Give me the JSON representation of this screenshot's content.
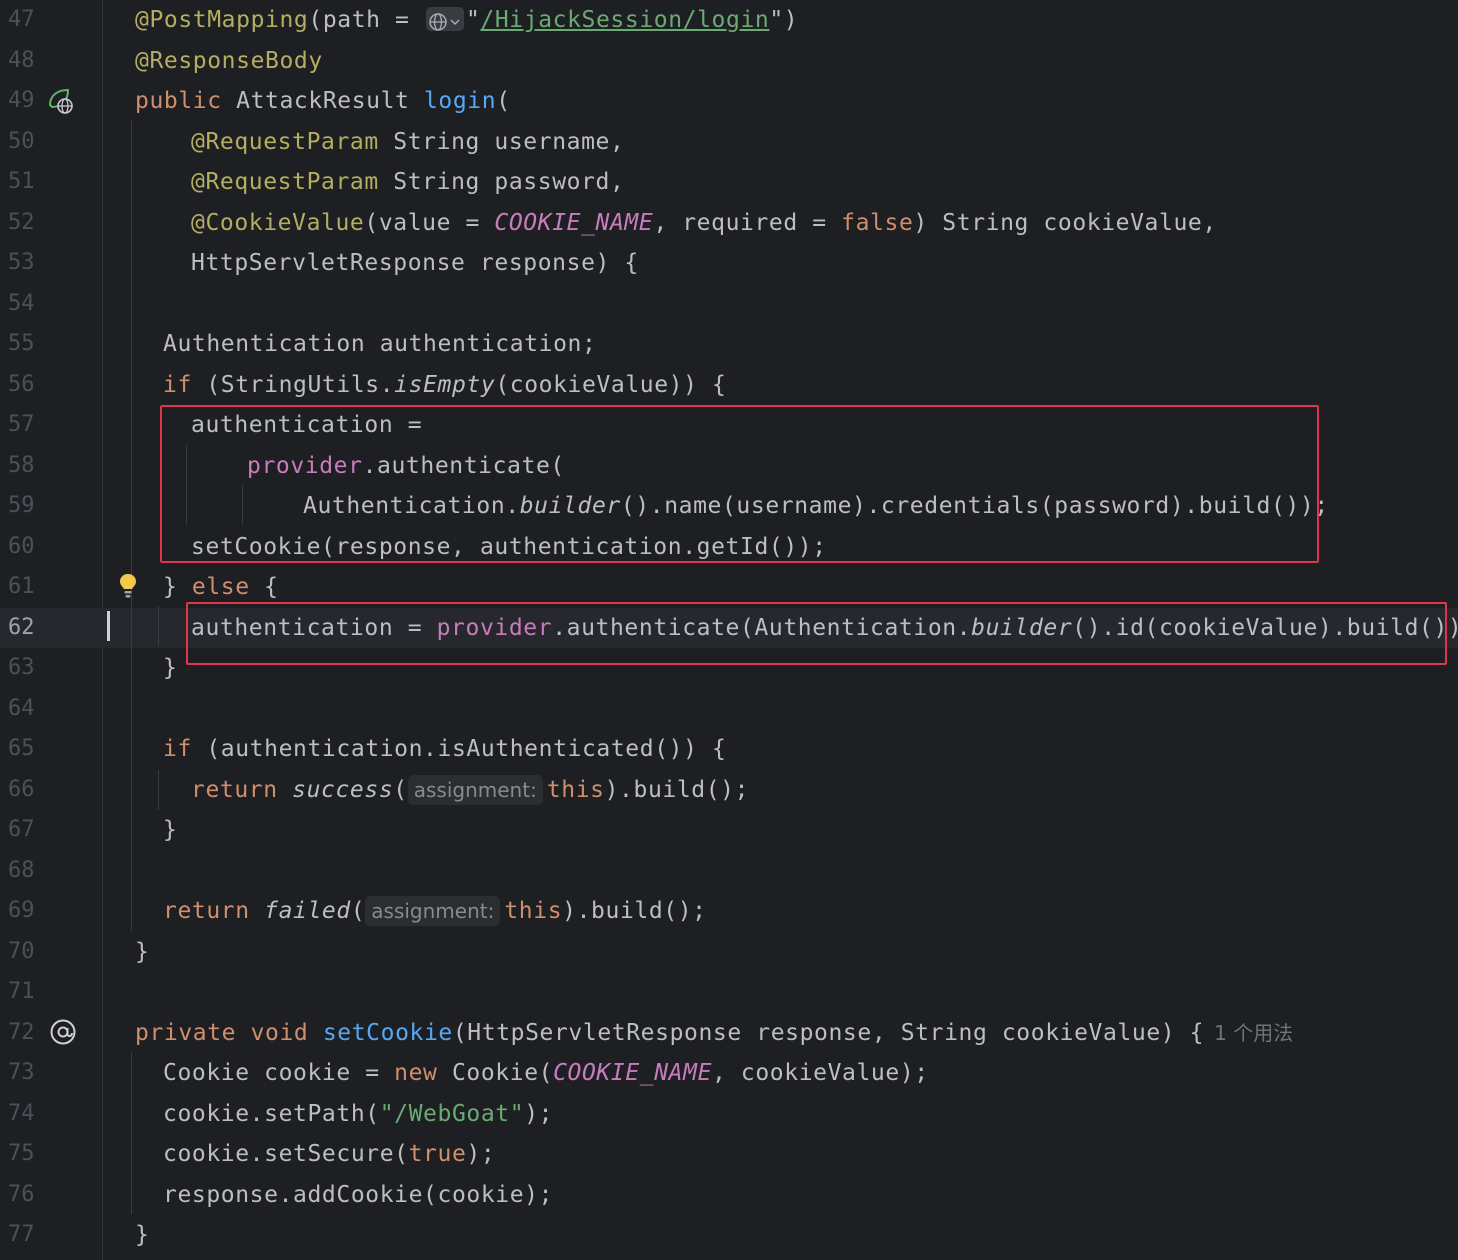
{
  "editor": {
    "lines": [
      {
        "n": "47",
        "tokens": [
          [
            "ann",
            "@PostMapping"
          ],
          [
            "",
            "(path = "
          ],
          [
            "globe",
            ""
          ],
          [
            "",
            "\""
          ],
          [
            "strlink",
            "/HijackSession/login"
          ],
          [
            "",
            "\")"
          ]
        ]
      },
      {
        "n": "48",
        "tokens": [
          [
            "ann",
            "@ResponseBody"
          ]
        ]
      },
      {
        "n": "49",
        "tokens": [
          [
            "kw",
            "public "
          ],
          [
            "",
            "AttackResult "
          ],
          [
            "fn",
            "login"
          ],
          [
            "",
            "("
          ]
        ]
      },
      {
        "n": "50",
        "tokens": [
          [
            "ann",
            "@RequestParam"
          ],
          [
            "",
            " String username,"
          ]
        ]
      },
      {
        "n": "51",
        "tokens": [
          [
            "ann",
            "@RequestParam"
          ],
          [
            "",
            " String password,"
          ]
        ]
      },
      {
        "n": "52",
        "tokens": [
          [
            "ann",
            "@CookieValue"
          ],
          [
            "",
            "(value = "
          ],
          [
            "const",
            "COOKIE_NAME"
          ],
          [
            "",
            ", required = "
          ],
          [
            "kw",
            "false"
          ],
          [
            "",
            ") String cookieValue,"
          ]
        ]
      },
      {
        "n": "53",
        "tokens": [
          [
            "",
            "HttpServletResponse response) {"
          ]
        ]
      },
      {
        "n": "54",
        "tokens": []
      },
      {
        "n": "55",
        "tokens": [
          [
            "",
            "Authentication authentication;"
          ]
        ]
      },
      {
        "n": "56",
        "tokens": [
          [
            "kw",
            "if "
          ],
          [
            "",
            "(StringUtils."
          ],
          [
            "st",
            "isEmpty"
          ],
          [
            "",
            "(cookieValue)) {"
          ]
        ]
      },
      {
        "n": "57",
        "tokens": [
          [
            "",
            "authentication ="
          ]
        ]
      },
      {
        "n": "58",
        "tokens": [
          [
            "fld",
            "provider"
          ],
          [
            "",
            ".authenticate("
          ]
        ]
      },
      {
        "n": "59",
        "tokens": [
          [
            "",
            "Authentication."
          ],
          [
            "st",
            "builder"
          ],
          [
            "",
            "().name(username).credentials(password).build());"
          ]
        ]
      },
      {
        "n": "60",
        "tokens": [
          [
            "",
            "setCookie(response, authentication.getId());"
          ]
        ]
      },
      {
        "n": "61",
        "tokens": [
          [
            "",
            "} "
          ],
          [
            "kw",
            "else"
          ],
          [
            "",
            " {"
          ]
        ]
      },
      {
        "n": "62",
        "tokens": [
          [
            "",
            "authentication = "
          ],
          [
            "fld",
            "provider"
          ],
          [
            "",
            ".authenticate(Authentication."
          ],
          [
            "st",
            "builder"
          ],
          [
            "",
            "().id(cookieValue).build());"
          ]
        ]
      },
      {
        "n": "63",
        "tokens": [
          [
            "",
            "}"
          ]
        ]
      },
      {
        "n": "64",
        "tokens": []
      },
      {
        "n": "65",
        "tokens": [
          [
            "kw",
            "if "
          ],
          [
            "",
            "(authentication.isAuthenticated()) {"
          ]
        ]
      },
      {
        "n": "66",
        "tokens": [
          [
            "kw",
            "return "
          ],
          [
            "st",
            "success"
          ],
          [
            "",
            "("
          ],
          [
            "hint",
            "assignment:"
          ],
          [
            "kw",
            "this"
          ],
          [
            "",
            ").build();"
          ]
        ]
      },
      {
        "n": "67",
        "tokens": [
          [
            "",
            "}"
          ]
        ]
      },
      {
        "n": "68",
        "tokens": []
      },
      {
        "n": "69",
        "tokens": [
          [
            "kw",
            "return "
          ],
          [
            "st",
            "failed"
          ],
          [
            "",
            "("
          ],
          [
            "hint",
            "assignment:"
          ],
          [
            "kw",
            "this"
          ],
          [
            "",
            ").build();"
          ]
        ]
      },
      {
        "n": "70",
        "tokens": [
          [
            "",
            "}"
          ]
        ]
      },
      {
        "n": "71",
        "tokens": []
      },
      {
        "n": "72",
        "tokens": [
          [
            "kw",
            "private void "
          ],
          [
            "fn",
            "setCookie"
          ],
          [
            "",
            "(HttpServletResponse response, String cookieValue) {"
          ],
          [
            "usage",
            "1 个用法"
          ]
        ]
      },
      {
        "n": "73",
        "tokens": [
          [
            "",
            "Cookie cookie = "
          ],
          [
            "kw",
            "new "
          ],
          [
            "",
            "Cookie("
          ],
          [
            "const",
            "COOKIE_NAME"
          ],
          [
            "",
            ", cookieValue);"
          ]
        ]
      },
      {
        "n": "74",
        "tokens": [
          [
            "",
            "cookie.setPath("
          ],
          [
            "str",
            "\"/WebGoat\""
          ],
          [
            "",
            ");"
          ]
        ]
      },
      {
        "n": "75",
        "tokens": [
          [
            "",
            "cookie.setSecure("
          ],
          [
            "kw",
            "true"
          ],
          [
            "",
            ");"
          ]
        ]
      },
      {
        "n": "76",
        "tokens": [
          [
            "",
            "response.addCookie(cookie);"
          ]
        ]
      },
      {
        "n": "77",
        "tokens": [
          [
            "",
            "}"
          ]
        ]
      }
    ],
    "current_line": "62",
    "colors": {
      "background": "#1e1f22",
      "annotation": "#b3ae60",
      "keyword": "#cf8e6d",
      "function": "#56a8f5",
      "field": "#c77dbb",
      "string": "#6aab73",
      "highlight_box": "#e0354a"
    }
  },
  "gutter_icons": {
    "line_49": "spring-web-endpoint-icon",
    "line_61": "lightbulb-icon",
    "line_72": "at-sign-icon"
  }
}
